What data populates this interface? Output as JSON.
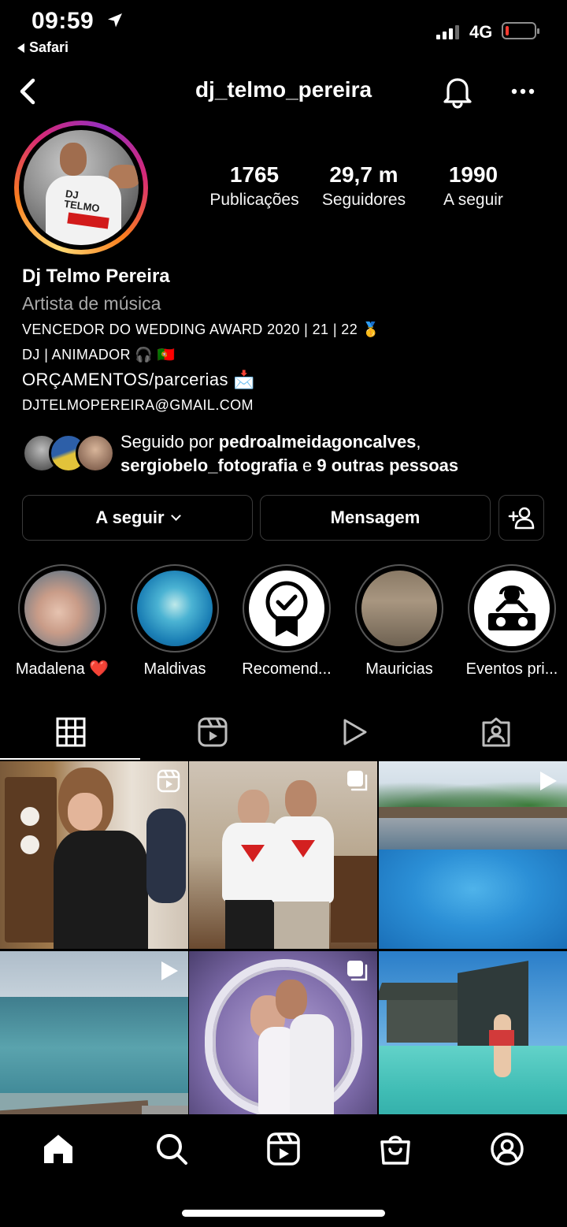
{
  "status_bar": {
    "time": "09:59",
    "back_app": "Safari",
    "network": "4G",
    "battery_level": 0.12,
    "battery_color": "#ff3b30"
  },
  "header": {
    "username": "dj_telmo_pereira",
    "back_icon": "chevron-left-icon",
    "notification_icon": "bell-icon",
    "more_icon": "more-horizontal-icon"
  },
  "stats": [
    {
      "value": "1765",
      "label": "Publicações"
    },
    {
      "value": "29,7 m",
      "label": "Seguidores"
    },
    {
      "value": "1990",
      "label": "A seguir"
    }
  ],
  "bio": {
    "name": "Dj Telmo Pereira",
    "category": "Artista de música",
    "lines": [
      "VENCEDOR DO WEDDING AWARD 2020 | 21 | 22 🥇",
      "DJ | ANIMADOR 🎧 🇵🇹",
      "ORÇAMENTOS/parcerias 📩",
      "DJTELMOPEREIRA@GMAIL.COM"
    ]
  },
  "followed_by": {
    "prefix": "Seguido por ",
    "user1": "pedroalmeidagoncalves",
    "sep": ",",
    "user2": "sergiobelo_fotografia",
    "mid": " e ",
    "others": "9 outras pessoas"
  },
  "buttons": {
    "following": "A seguir",
    "message": "Mensagem",
    "add_person_icon": "add-person-icon"
  },
  "highlights": [
    {
      "label": "Madalena ❤️"
    },
    {
      "label": "Maldivas"
    },
    {
      "label": "Recomend..."
    },
    {
      "label": "Mauricias"
    },
    {
      "label": "Eventos pri..."
    }
  ],
  "tabs": [
    "grid-icon",
    "reels-icon",
    "video-play-icon",
    "tagged-icon"
  ],
  "bottom_nav": [
    "home-icon",
    "search-icon",
    "reels-icon",
    "shop-icon",
    "profile-icon"
  ],
  "colors": {
    "background": "#000000",
    "muted_text": "#a8a8a8",
    "button_border": "#3a3a3a",
    "story_ring_start": "#feda75",
    "story_ring_end": "#d62976"
  }
}
